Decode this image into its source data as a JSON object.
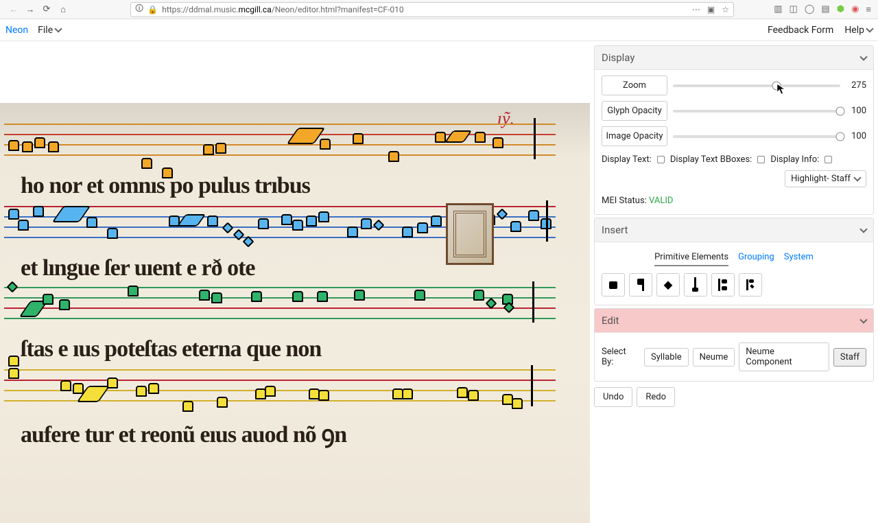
{
  "browser": {
    "url_prefix": "https://ddmal.music.",
    "url_host": "mcgill.ca",
    "url_suffix": "/Neon/editor.html?manifest=CF-010"
  },
  "appbar": {
    "brand": "Neon",
    "file": "File",
    "feedback": "Feedback Form",
    "help": "Help"
  },
  "display": {
    "title": "Display",
    "zoom_label": "Zoom",
    "zoom_value": "275",
    "zoom_pct": 62,
    "glyph_label": "Glyph Opacity",
    "glyph_value": "100",
    "image_label": "Image Opacity",
    "image_value": "100",
    "display_text": "Display Text:",
    "display_bboxes": "Display Text BBoxes:",
    "display_info": "Display Info:",
    "highlight": "Highlight- Staff",
    "mei_label": "MEI Status: ",
    "mei_value": "VALID"
  },
  "insert": {
    "title": "Insert",
    "tabs": {
      "primitive": "Primitive Elements",
      "grouping": "Grouping",
      "system": "System"
    }
  },
  "edit": {
    "title": "Edit",
    "select_by": "Select By:",
    "options": {
      "syllable": "Syllable",
      "neume": "Neume",
      "nc": "Neume Component",
      "staff": "Staff"
    }
  },
  "actions": {
    "undo": "Undo",
    "redo": "Redo"
  },
  "manuscript": {
    "rubric": "ıỹ.",
    "lines": [
      "ho    nor et omnıs po  pulus trıbus",
      "et lıngue ſer         uıent e      rð     ote",
      "ſtas   e   ıus poteſtas eterna que non",
      "aufere  tur  et  reonũ  eıus auod nõ  ꝯn"
    ]
  }
}
